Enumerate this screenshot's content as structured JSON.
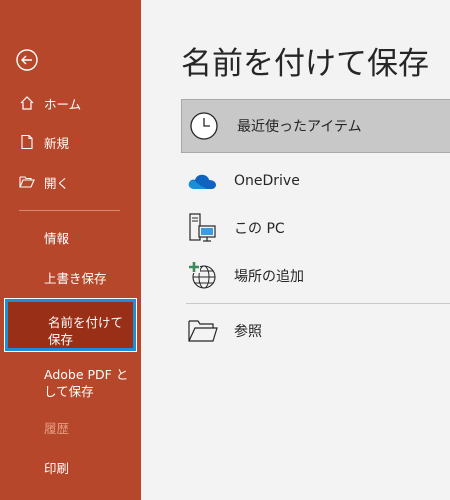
{
  "sidebar": {
    "back_label": "",
    "home": "ホーム",
    "new": "新規",
    "open": "開く",
    "info": "情報",
    "save": "上書き保存",
    "save_as": "名前を付けて保存",
    "save_pdf": "Adobe PDF として保存",
    "history": "履歴",
    "print": "印刷"
  },
  "main": {
    "title": "名前を付けて保存",
    "recent": "最近使ったアイテム",
    "locations": [
      "OneDrive",
      "この PC",
      "場所の追加"
    ],
    "browse": "参照"
  },
  "colors": {
    "sidebar_bg": "#b7472a",
    "selected_border": "#1a8fd6",
    "onedrive_blue": "#0f64c2"
  }
}
